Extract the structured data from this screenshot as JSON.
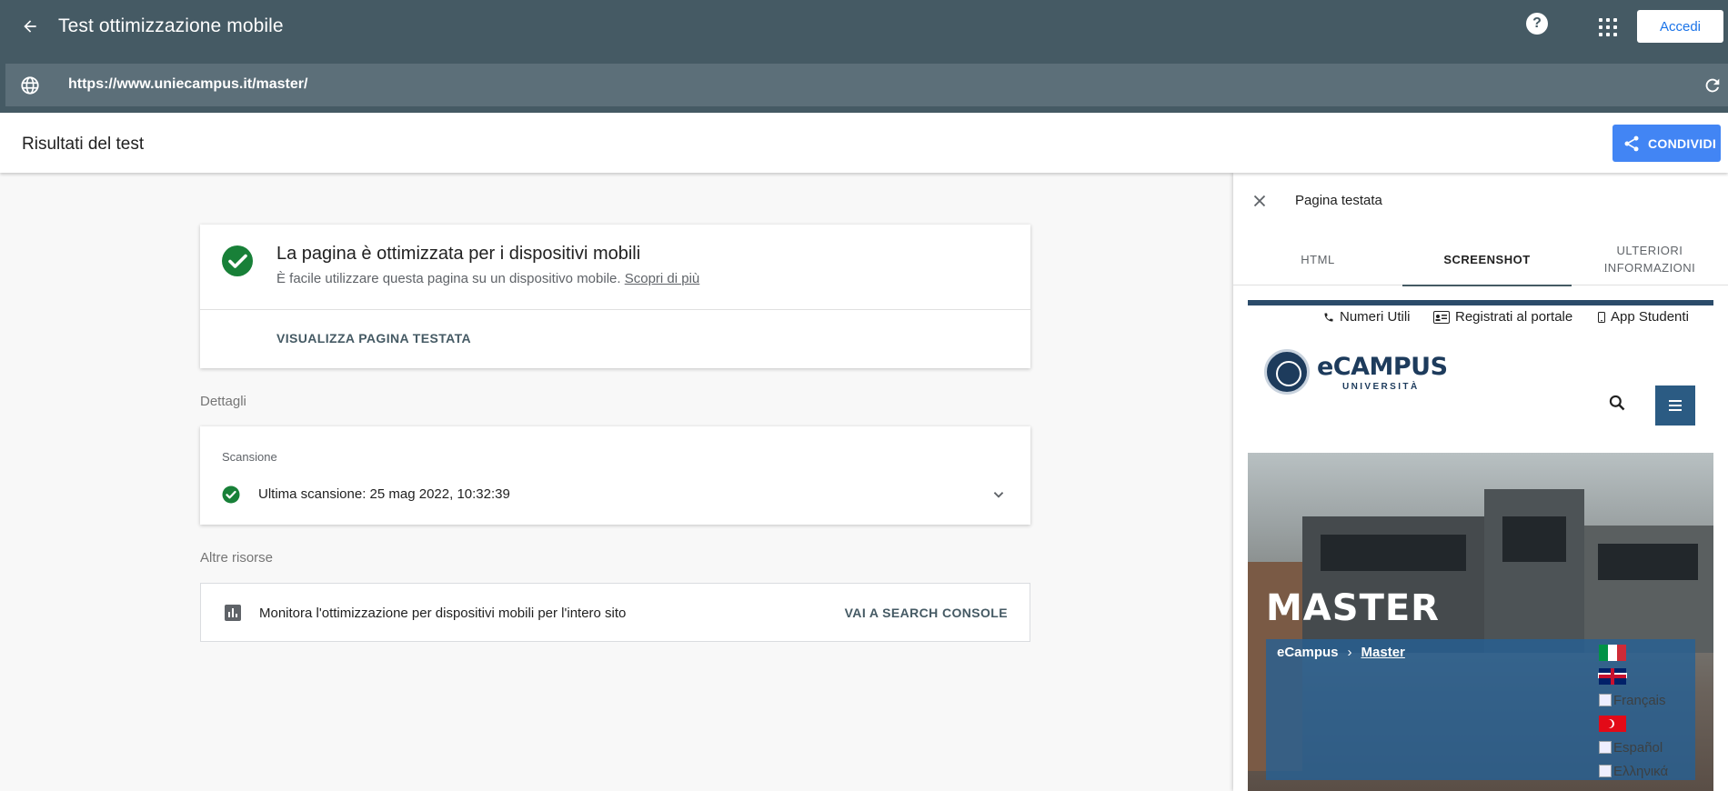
{
  "topbar": {
    "title": "Test ottimizzazione mobile",
    "signin_label": "Accedi",
    "help_glyph": "?",
    "back_icon": "arrow-back-icon",
    "help_icon": "help-icon",
    "apps_icon": "apps-grid-icon"
  },
  "urlbar": {
    "url": "https://www.uniecampus.it/master/",
    "globe_icon": "globe-icon",
    "reload_icon": "reload-icon"
  },
  "results": {
    "title": "Risultati del test",
    "share_label": "CONDIVIDI",
    "share_icon": "share-icon"
  },
  "status_card": {
    "title": "La pagina è ottimizzata per i dispositivi mobili",
    "subtitle": "È facile utilizzare questa pagina su un dispositivo mobile.",
    "learn_more": "Scopri di più",
    "view_tested_page": "VISUALIZZA PAGINA TESTATA"
  },
  "details": {
    "section_label": "Dettagli",
    "scan_label": "Scansione",
    "last_scan": "Ultima scansione: 25 mag 2022, 10:32:39"
  },
  "resources": {
    "section_label": "Altre risorse",
    "text": "Monitora l'ottimizzazione per dispositivi mobili per l'intero sito",
    "link": "VAI A SEARCH CONSOLE"
  },
  "panel": {
    "title": "Pagina testata",
    "tabs": [
      {
        "label": "HTML",
        "active": false
      },
      {
        "label": "SCREENSHOT",
        "active": true
      },
      {
        "label": "ULTERIORI INFORMAZIONI",
        "active": false
      }
    ]
  },
  "screenshot": {
    "utility_links": [
      "Numeri Utili",
      "Registrati al portale",
      "App Studenti"
    ],
    "logo_word": "eCAMPUS",
    "logo_sub": "UNIVERSITÀ",
    "hero_title": "MASTER",
    "breadcrumb": [
      "eCampus",
      "Master"
    ],
    "breadcrumb_sep": "›",
    "languages_alt": [
      "Français",
      "Español",
      "Ελληνικά"
    ]
  },
  "colors": {
    "topbar": "#455a64",
    "urlbar": "#5c6f79",
    "accent_blue": "#4285f4",
    "success_green": "#188038"
  }
}
